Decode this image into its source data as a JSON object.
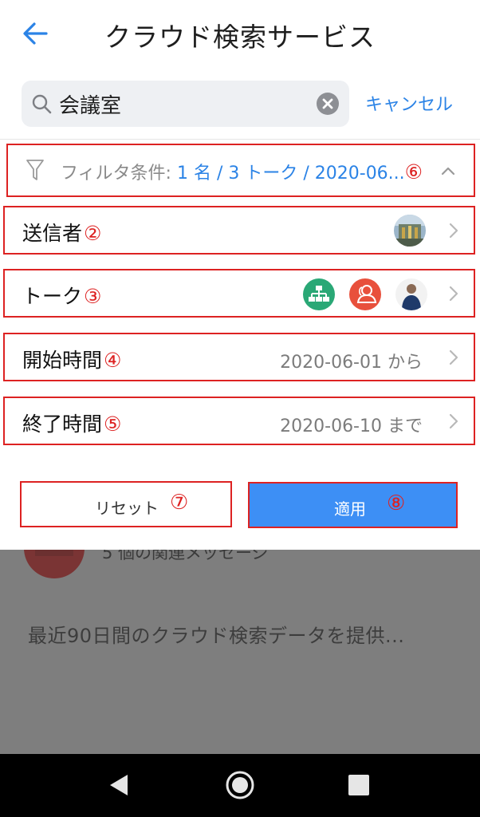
{
  "header": {
    "title": "クラウド検索サービス"
  },
  "search": {
    "query": "会議室",
    "cancel_label": "キャンセル"
  },
  "filter": {
    "label": "フィルタ条件:",
    "summary": "1 名 / 3 トーク / 2020-06...",
    "marker": "⑥"
  },
  "rows": {
    "sender": {
      "label": "送信者",
      "marker": "②"
    },
    "talk": {
      "label": "トーク",
      "marker": "③"
    },
    "start": {
      "label": "開始時間",
      "marker": "④",
      "value": "2020-06-01 から"
    },
    "end": {
      "label": "終了時間",
      "marker": "⑤",
      "value": "2020-06-10 まで"
    }
  },
  "buttons": {
    "reset_label": "リセット",
    "reset_marker": "⑦",
    "apply_label": "適用",
    "apply_marker": "⑧"
  },
  "background": {
    "related": "5 個の関連メッセージ",
    "info": "最近90日間のクラウド検索データを提供..."
  },
  "colors": {
    "accent": "#2b83e6",
    "apply": "#3d8ff5",
    "annotation": "#dd2222",
    "talk_green": "#2aa876",
    "talk_red": "#e8503c"
  }
}
